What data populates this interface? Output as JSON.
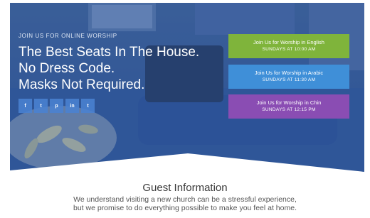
{
  "hero": {
    "eyebrow": "JOIN US FOR ONLINE WORSHIP",
    "headline_lines": [
      "The Best Seats In The House.",
      "No Dress Code.",
      "Masks Not Required."
    ],
    "social_icons": [
      {
        "icon": "facebook-icon",
        "glyph": "f"
      },
      {
        "icon": "twitter-icon",
        "glyph": "t"
      },
      {
        "icon": "pinterest-icon",
        "glyph": "p"
      },
      {
        "icon": "linkedin-icon",
        "glyph": "in"
      },
      {
        "icon": "tumblr-icon",
        "glyph": "t"
      }
    ]
  },
  "worship_buttons": [
    {
      "label": "Join Us for Worship in English",
      "time": "SUNDAYS AT 10:00 AM",
      "color": "#7fb43b"
    },
    {
      "label": "Join Us for Worship in Arabic",
      "time": "SUNDAYS AT 11:30 AM",
      "color": "#3f8fd8"
    },
    {
      "label": "Join Us for Worship in Chin",
      "time": "SUNDAYS AT 12:15 PM",
      "color": "#8a4db3"
    }
  ],
  "guest": {
    "title": "Guest Information",
    "text_lines": [
      "We understand visiting a new church can be a stressful experience,",
      "but we promise to do everything possible to make you feel at home."
    ]
  }
}
